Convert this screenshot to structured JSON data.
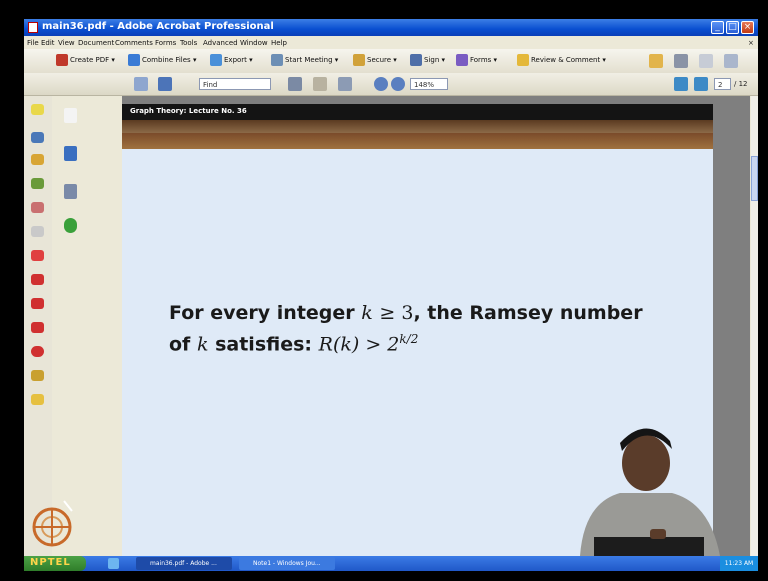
{
  "window": {
    "title": "main36.pdf - Adobe Acrobat Professional"
  },
  "menu": [
    "File",
    "Edit",
    "View",
    "Document",
    "Comments",
    "Forms",
    "Tools",
    "Advanced",
    "Window",
    "Help"
  ],
  "toolbar": {
    "create_pdf": "Create PDF",
    "combine_files": "Combine Files",
    "export": "Export",
    "start_meeting": "Start Meeting",
    "secure": "Secure",
    "sign": "Sign",
    "forms": "Forms",
    "review_comment": "Review & Comment"
  },
  "nav_toolbar": {
    "find_placeholder": "Find",
    "zoom": "148%",
    "page_current": "2",
    "page_total": "/ 12"
  },
  "document": {
    "header": "Graph Theory: Lecture No. 36",
    "theorem_prefix": "For every integer",
    "theorem_var_k": "k",
    "theorem_cond": "≥ 3",
    "theorem_mid": ", the Ramsey number",
    "theorem_of": "of",
    "theorem_satisfies": "satisfies:",
    "theorem_formula": "R(k) > 2",
    "theorem_exp": "k/2"
  },
  "taskbar": {
    "start": "NPTEL",
    "tasks": [
      "main36.pdf - Adobe ...",
      "Note1 - Windows Jou..."
    ],
    "clock": "11:23 AM"
  }
}
